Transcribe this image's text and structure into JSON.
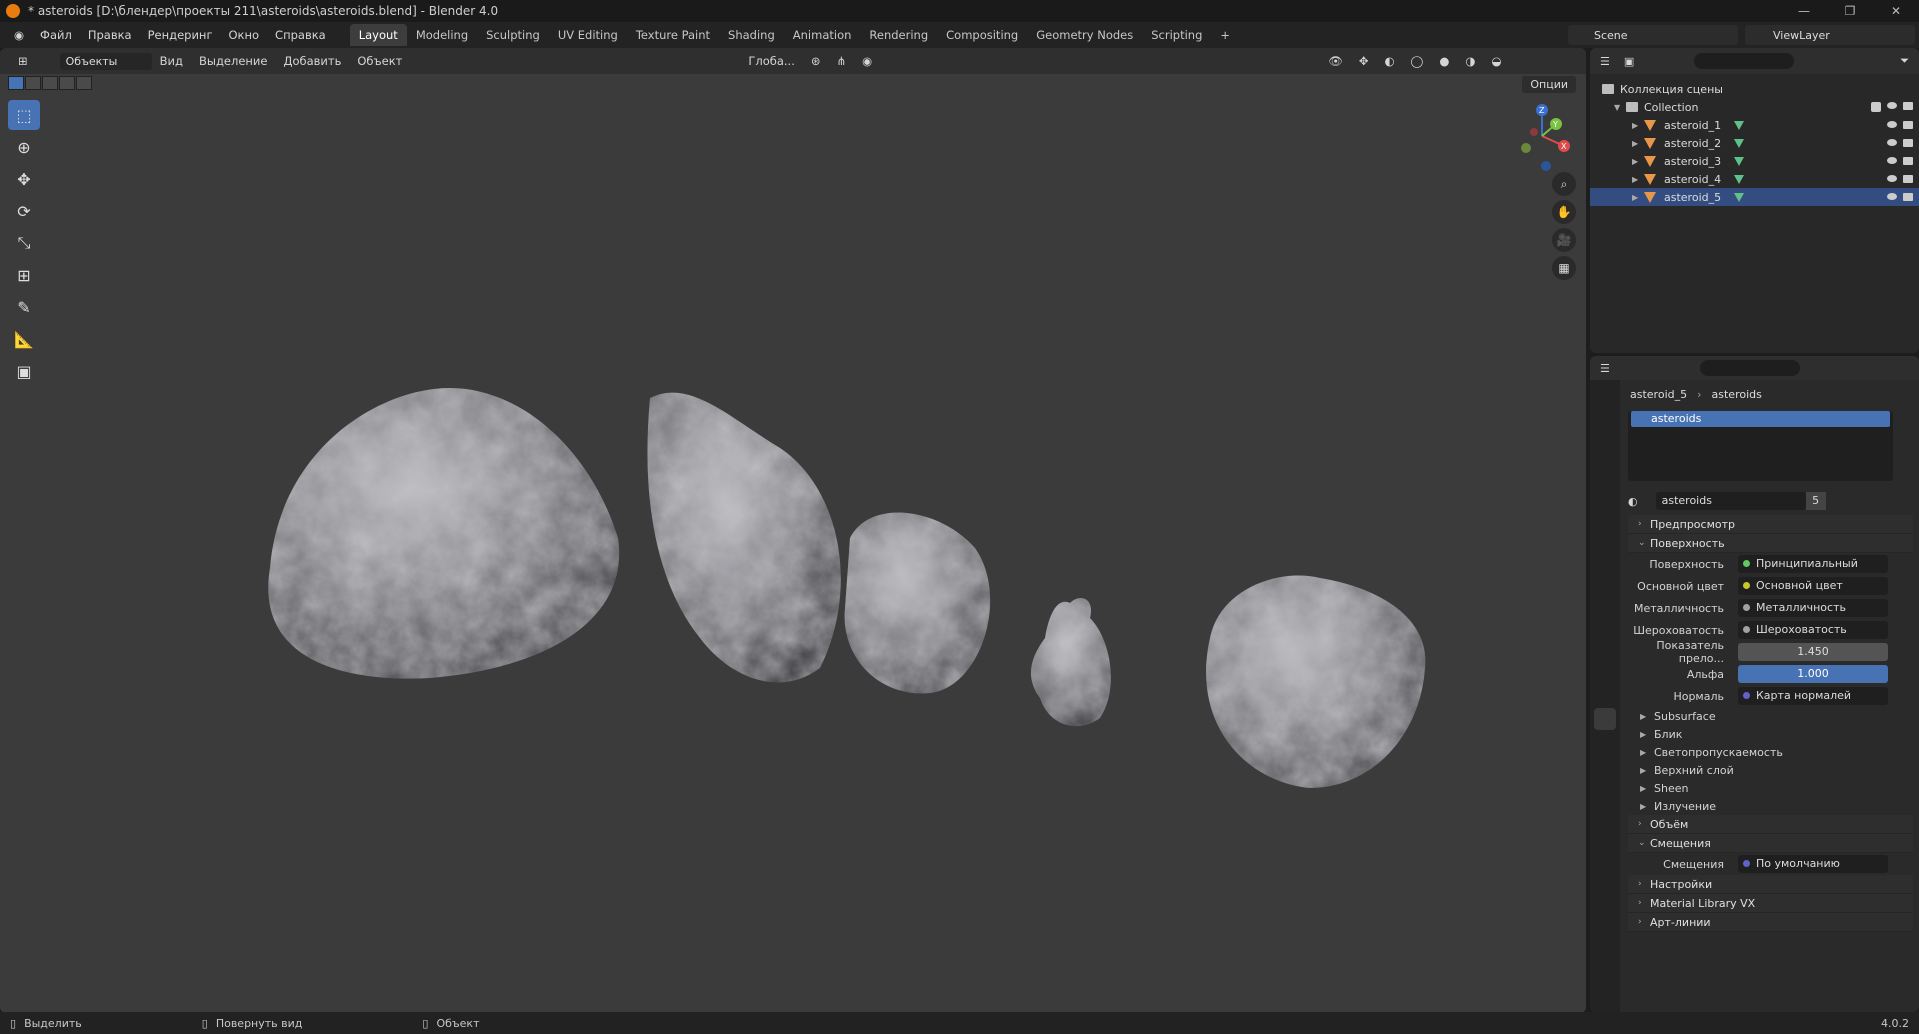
{
  "window": {
    "title": "* asteroids [D:\\блендер\\проекты 211\\asteroids\\asteroids.blend] - Blender 4.0",
    "controls": [
      "—",
      "❐",
      "✕"
    ]
  },
  "menu": [
    "Файл",
    "Правка",
    "Рендеринг",
    "Окно",
    "Справка"
  ],
  "workspaces": [
    {
      "label": "Layout",
      "active": true
    },
    {
      "label": "Modeling"
    },
    {
      "label": "Sculpting"
    },
    {
      "label": "UV Editing"
    },
    {
      "label": "Texture Paint"
    },
    {
      "label": "Shading"
    },
    {
      "label": "Animation"
    },
    {
      "label": "Rendering"
    },
    {
      "label": "Compositing"
    },
    {
      "label": "Geometry Nodes"
    },
    {
      "label": "Scripting"
    },
    {
      "label": "+"
    }
  ],
  "scene": "Scene",
  "view_layer": "ViewLayer",
  "viewport": {
    "mode": "Объекты",
    "menu": [
      "Вид",
      "Выделение",
      "Добавить",
      "Объект"
    ],
    "orientation": "Глоба...",
    "options": "Опции",
    "gizmo": {
      "z": "Z",
      "y": "Y",
      "x": "X"
    }
  },
  "outliner": {
    "root": "Коллекция сцены",
    "collection": "Collection",
    "objects": [
      {
        "name": "asteroid_1"
      },
      {
        "name": "asteroid_2"
      },
      {
        "name": "asteroid_3"
      },
      {
        "name": "asteroid_4"
      },
      {
        "name": "asteroid_5",
        "selected": true
      }
    ]
  },
  "properties": {
    "breadcrumb": {
      "object": "asteroid_5",
      "material": "asteroids"
    },
    "slots": [
      "asteroids"
    ],
    "material_name": "asteroids",
    "users": "5",
    "panels": {
      "preview": "Предпросмотр",
      "surface": "Поверхность",
      "volume": "Объём",
      "displacement": "Смещения",
      "settings": "Настройки",
      "matlib": "Material Library VX",
      "lineart": "Арт-линии"
    },
    "surface_label": "Поверхность",
    "surface_value": "Принципиальный BSDF",
    "inputs": [
      {
        "label": "Основной цвет",
        "value": "Основной цвет",
        "socket": "yellow",
        "expand": true
      },
      {
        "label": "Металличность",
        "value": "Металличность",
        "socket": "gray",
        "expand": true
      },
      {
        "label": "Шероховатость",
        "value": "Шероховатость",
        "socket": "gray",
        "expand": true
      },
      {
        "label": "Показатель прело...",
        "value": "1.450",
        "socket": "gray",
        "kind": "num"
      },
      {
        "label": "Альфа",
        "value": "1.000",
        "socket": "gray",
        "kind": "blue"
      },
      {
        "label": "Нормаль",
        "value": "Карта нормалей",
        "socket": "purple",
        "expand": true
      }
    ],
    "subpanels": [
      "Subsurface",
      "Блик",
      "Светопропускаемость",
      "Верхний слой",
      "Sheen",
      "Излучение"
    ],
    "displacement_label": "Смещения",
    "displacement_value": "По умолчанию"
  },
  "status": {
    "select": "Выделить",
    "rotate": "Повернуть вид",
    "object": "Объект",
    "version": "4.0.2"
  }
}
